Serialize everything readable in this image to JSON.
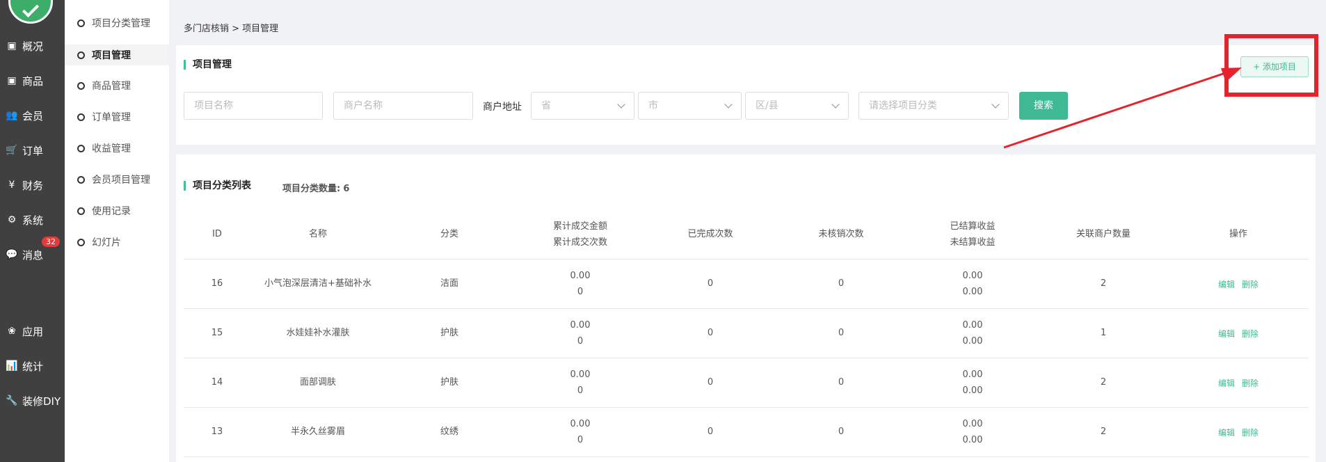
{
  "nav": {
    "items": [
      {
        "label": "概况",
        "icon": "dashboard-icon",
        "glyph": "▣"
      },
      {
        "label": "商品",
        "icon": "goods-icon",
        "glyph": "▣"
      },
      {
        "label": "会员",
        "icon": "members-icon",
        "glyph": "👥"
      },
      {
        "label": "订单",
        "icon": "cart-icon",
        "glyph": "🛒"
      },
      {
        "label": "财务",
        "icon": "yen-icon",
        "glyph": "¥"
      },
      {
        "label": "系统",
        "icon": "gears-icon",
        "glyph": "⚙"
      },
      {
        "label": "消息",
        "icon": "chat-icon",
        "glyph": "💬"
      },
      {
        "label": "应用",
        "icon": "apps-icon",
        "glyph": "❀"
      },
      {
        "label": "统计",
        "icon": "chart-icon",
        "glyph": "📊"
      },
      {
        "label": "装修DIY",
        "icon": "wrench-icon",
        "glyph": "🔧"
      }
    ],
    "message_badge": "32"
  },
  "subnav": {
    "items": [
      {
        "label": "项目分类管理"
      },
      {
        "label": "项目管理"
      },
      {
        "label": "商品管理"
      },
      {
        "label": "订单管理"
      },
      {
        "label": "收益管理"
      },
      {
        "label": "会员项目管理"
      },
      {
        "label": "使用记录"
      },
      {
        "label": "幻灯片"
      }
    ],
    "active_index": 1
  },
  "breadcrumb": "多门店核销 > 项目管理",
  "filter": {
    "title": "项目管理",
    "project_name_placeholder": "项目名称",
    "merchant_name_placeholder": "商户名称",
    "address_label": "商户地址",
    "province_placeholder": "省",
    "city_placeholder": "市",
    "district_placeholder": "区/县",
    "category_placeholder": "请选择项目分类",
    "search_label": "搜索",
    "add_label": "+ 添加项目"
  },
  "list": {
    "title": "项目分类列表",
    "count_label": "项目分类数量:",
    "count_value": "6",
    "headers": {
      "id": "ID",
      "name": "名称",
      "category": "分类",
      "amount_1": "累计成交金额",
      "amount_2": "累计成交次数",
      "completed": "已完成次数",
      "unverified": "未核销次数",
      "income_1": "已结算收益",
      "income_2": "未结算收益",
      "merchants": "关联商户数量",
      "actions": "操作"
    },
    "rows": [
      {
        "id": "16",
        "name": "小气泡深层清洁+基础补水",
        "category": "洁面",
        "amount": "0.00",
        "times": "0",
        "completed": "0",
        "unverified": "0",
        "settled": "0.00",
        "unsettled": "0.00",
        "merchants": "2",
        "edit": "编辑",
        "delete": "删除"
      },
      {
        "id": "15",
        "name": "水娃娃补水灌肤",
        "category": "护肤",
        "amount": "0.00",
        "times": "0",
        "completed": "0",
        "unverified": "0",
        "settled": "0.00",
        "unsettled": "0.00",
        "merchants": "1",
        "edit": "编辑",
        "delete": "删除"
      },
      {
        "id": "14",
        "name": "面部调肤",
        "category": "护肤",
        "amount": "0.00",
        "times": "0",
        "completed": "0",
        "unverified": "0",
        "settled": "0.00",
        "unsettled": "0.00",
        "merchants": "2",
        "edit": "编辑",
        "delete": "删除"
      },
      {
        "id": "13",
        "name": "半永久丝雾眉",
        "category": "纹绣",
        "amount": "0.00",
        "times": "0",
        "completed": "0",
        "unverified": "0",
        "settled": "0.00",
        "unsettled": "0.00",
        "merchants": "2",
        "edit": "编辑",
        "delete": "删除"
      }
    ]
  },
  "colors": {
    "accent": "#3fb894",
    "annotation": "#e8222a",
    "nav_bg": "#404040"
  }
}
